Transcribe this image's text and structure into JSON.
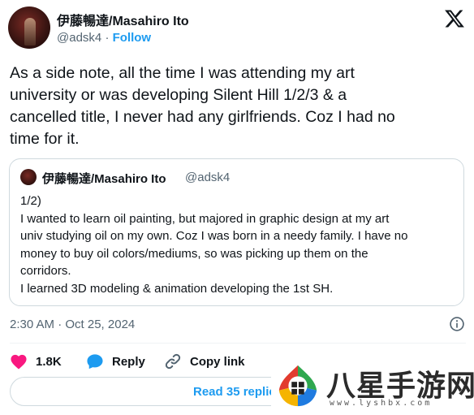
{
  "author": {
    "name": "伊藤暢達/Masahiro Ito",
    "handle": "@adsk4",
    "separator": "·",
    "follow_label": "Follow"
  },
  "tweet": {
    "lines": [
      "As a side note, all the time I was attending my art",
      "university or was developing Silent Hill 1/2/3 & a",
      "cancelled title, I never had any girlfriends. Coz I had no",
      "time for it."
    ]
  },
  "quote": {
    "name": "伊藤暢達/Masahiro Ito",
    "handle": "@adsk4",
    "lines": [
      "1/2)",
      "I wanted to learn oil painting, but majored in graphic design at my art",
      "univ studying oil on my own. Coz I was born in a needy family. I have no",
      "money to buy oil colors/mediums, so was picking up them on the",
      "corridors.",
      "I learned 3D modeling & animation developing the 1st SH."
    ]
  },
  "timestamp": "2:30 AM · Oct 25, 2024",
  "actions": {
    "like_count": "1.8K",
    "reply_label": "Reply",
    "copy_label": "Copy link"
  },
  "read_replies_label": "Read 35 replies",
  "watermark": {
    "title": "八星手游网",
    "url": "www.lyshbx.com"
  },
  "colors": {
    "accent": "#1d9bf0",
    "like": "#f91880",
    "text": "#0f1419",
    "secondary": "#536471",
    "border": "#cfd9de"
  },
  "icons": [
    "x-logo-icon",
    "info-icon",
    "heart-icon",
    "reply-bubble-icon",
    "link-icon"
  ]
}
